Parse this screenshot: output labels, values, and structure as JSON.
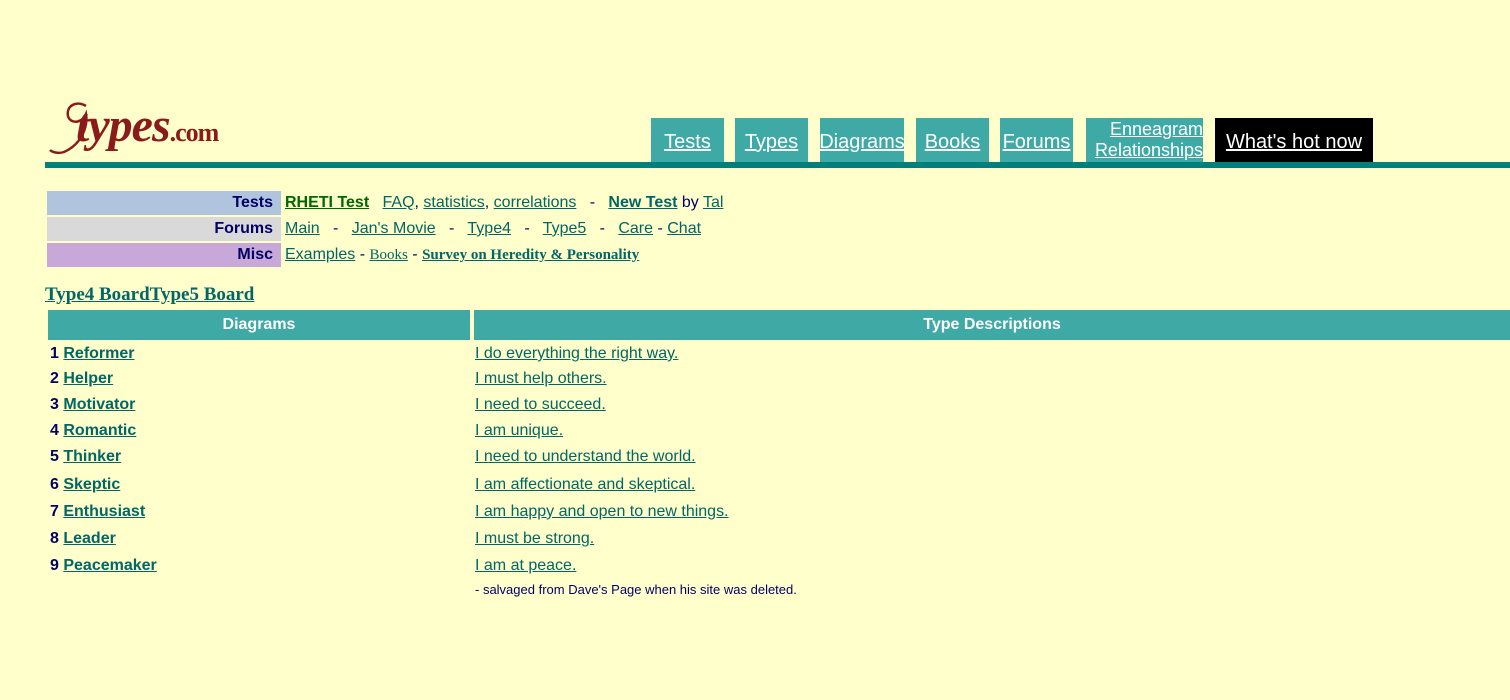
{
  "logo": {
    "brand": "types",
    "numeral": "9",
    "tld": ".com"
  },
  "nav": {
    "tabs": [
      {
        "label": "Tests"
      },
      {
        "label": "Types"
      },
      {
        "label": "Diagrams"
      },
      {
        "label": "Books"
      },
      {
        "label": "Forums"
      },
      {
        "label": "Enneagram Relationships",
        "line1": "Enneagram",
        "line2": "Relationships"
      },
      {
        "label": "What's hot now"
      }
    ]
  },
  "subnav": {
    "tests": {
      "label": "Tests",
      "rheti": "RHETI Test",
      "faq": "FAQ",
      "comma": ",",
      "statistics": "statistics",
      "correlations": "correlations",
      "dash": "-",
      "new_test": "New Test",
      "by": "by",
      "tal": "Tal"
    },
    "forums": {
      "label": "Forums",
      "main": "Main",
      "jans_movie": "Jan's Movie",
      "type4": "Type4",
      "type5": "Type5",
      "care": "Care",
      "chat": "Chat",
      "dash": "-"
    },
    "misc": {
      "label": "Misc",
      "examples": "Examples",
      "books": "Books",
      "survey": "Survey on Heredity & Personality",
      "dash": "-"
    }
  },
  "board_title": "Type4 BoardType5 Board",
  "table": {
    "headers": [
      "Diagrams",
      "Type Descriptions"
    ],
    "rows": [
      {
        "num": "1",
        "type": "Reformer",
        "desc": "I do everything the right way."
      },
      {
        "num": "2",
        "type": "Helper",
        "desc": "I must help others."
      },
      {
        "num": "3",
        "type": "Motivator",
        "desc": "I need to succeed."
      },
      {
        "num": "4",
        "type": "Romantic",
        "desc": "I am unique."
      },
      {
        "num": "5",
        "type": "Thinker",
        "desc": "I need to understand the world."
      },
      {
        "num": "6",
        "type": "Skeptic",
        "desc": "I am affectionate and skeptical."
      },
      {
        "num": "7",
        "type": "Enthusiast",
        "desc": "I am happy and open to new things."
      },
      {
        "num": "8",
        "type": "Leader",
        "desc": "I must be strong."
      },
      {
        "num": "9",
        "type": "Peacemaker",
        "desc": "I am at peace."
      }
    ],
    "note": "- salvaged from Dave's Page when his site was deleted."
  },
  "colors": {
    "background": "#ffffcc",
    "teal": "#3fa9a6",
    "rule": "#00807c",
    "link": "#006666",
    "tests_bg": "#b0c4de",
    "forums_bg": "#d9d9d9",
    "misc_bg": "#c8a8d8",
    "logo": "#8b1a1a"
  }
}
